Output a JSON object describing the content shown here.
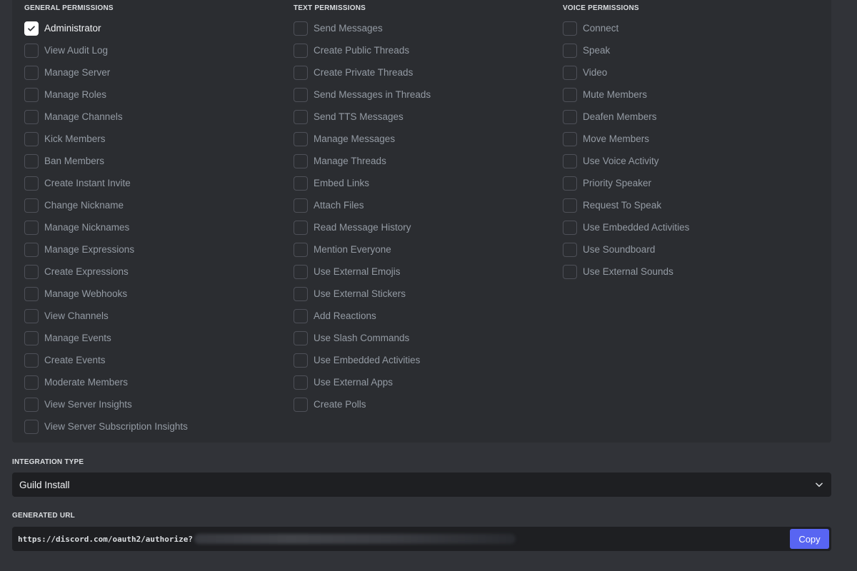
{
  "permissions": {
    "general": {
      "header": "GENERAL PERMISSIONS",
      "items": [
        {
          "label": "Administrator",
          "checked": true
        },
        {
          "label": "View Audit Log",
          "checked": false
        },
        {
          "label": "Manage Server",
          "checked": false
        },
        {
          "label": "Manage Roles",
          "checked": false
        },
        {
          "label": "Manage Channels",
          "checked": false
        },
        {
          "label": "Kick Members",
          "checked": false
        },
        {
          "label": "Ban Members",
          "checked": false
        },
        {
          "label": "Create Instant Invite",
          "checked": false
        },
        {
          "label": "Change Nickname",
          "checked": false
        },
        {
          "label": "Manage Nicknames",
          "checked": false
        },
        {
          "label": "Manage Expressions",
          "checked": false
        },
        {
          "label": "Create Expressions",
          "checked": false
        },
        {
          "label": "Manage Webhooks",
          "checked": false
        },
        {
          "label": "View Channels",
          "checked": false
        },
        {
          "label": "Manage Events",
          "checked": false
        },
        {
          "label": "Create Events",
          "checked": false
        },
        {
          "label": "Moderate Members",
          "checked": false
        },
        {
          "label": "View Server Insights",
          "checked": false
        },
        {
          "label": "View Server Subscription Insights",
          "checked": false
        }
      ]
    },
    "text": {
      "header": "TEXT PERMISSIONS",
      "items": [
        {
          "label": "Send Messages",
          "checked": false
        },
        {
          "label": "Create Public Threads",
          "checked": false
        },
        {
          "label": "Create Private Threads",
          "checked": false
        },
        {
          "label": "Send Messages in Threads",
          "checked": false
        },
        {
          "label": "Send TTS Messages",
          "checked": false
        },
        {
          "label": "Manage Messages",
          "checked": false
        },
        {
          "label": "Manage Threads",
          "checked": false
        },
        {
          "label": "Embed Links",
          "checked": false
        },
        {
          "label": "Attach Files",
          "checked": false
        },
        {
          "label": "Read Message History",
          "checked": false
        },
        {
          "label": "Mention Everyone",
          "checked": false
        },
        {
          "label": "Use External Emojis",
          "checked": false
        },
        {
          "label": "Use External Stickers",
          "checked": false
        },
        {
          "label": "Add Reactions",
          "checked": false
        },
        {
          "label": "Use Slash Commands",
          "checked": false
        },
        {
          "label": "Use Embedded Activities",
          "checked": false
        },
        {
          "label": "Use External Apps",
          "checked": false
        },
        {
          "label": "Create Polls",
          "checked": false
        }
      ]
    },
    "voice": {
      "header": "VOICE PERMISSIONS",
      "items": [
        {
          "label": "Connect",
          "checked": false
        },
        {
          "label": "Speak",
          "checked": false
        },
        {
          "label": "Video",
          "checked": false
        },
        {
          "label": "Mute Members",
          "checked": false
        },
        {
          "label": "Deafen Members",
          "checked": false
        },
        {
          "label": "Move Members",
          "checked": false
        },
        {
          "label": "Use Voice Activity",
          "checked": false
        },
        {
          "label": "Priority Speaker",
          "checked": false
        },
        {
          "label": "Request To Speak",
          "checked": false
        },
        {
          "label": "Use Embedded Activities",
          "checked": false
        },
        {
          "label": "Use Soundboard",
          "checked": false
        },
        {
          "label": "Use External Sounds",
          "checked": false
        }
      ]
    }
  },
  "integration": {
    "label": "INTEGRATION TYPE",
    "selected": "Guild Install"
  },
  "generated_url": {
    "label": "GENERATED URL",
    "value": "https://discord.com/oauth2/authorize?",
    "copy_label": "Copy"
  },
  "colors": {
    "accent": "#5865f2",
    "background": "#313338",
    "panel": "#2b2d31",
    "input": "#1e1f22"
  }
}
